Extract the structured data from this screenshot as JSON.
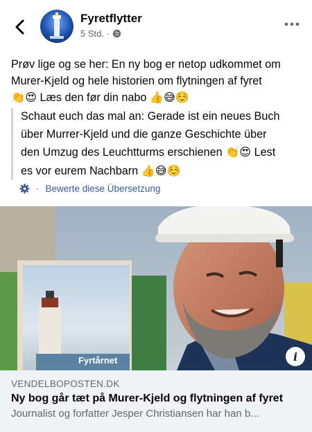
{
  "header": {
    "page_name": "Fyretflytter",
    "time": "5 Std.",
    "separator": "·",
    "back_icon": "chevron-left-icon",
    "privacy_icon": "globe-icon",
    "more_icon": "more-dots-icon"
  },
  "post": {
    "line1": "Prøv lige og se her: En ny bog er netop udkommet om",
    "line2": "Murer-Kjeld og hele historien om flytningen af fyret",
    "line3_emoji_a": "👏😍",
    "line3_text": " Læs den før din nabo ",
    "line3_emoji_b": "👍😅☺️"
  },
  "translation": {
    "line1": "Schaut euch das mal an: Gerade ist ein neues Buch",
    "line2": "über Murrer-Kjeld und die ganze Geschichte über",
    "line3_text": "den Umzug des Leuchtturms erschienen ",
    "line3_emoji": "👏😍",
    "line3_tail": " Lest",
    "line4_text": "es vor eurem Nachbarn ",
    "line4_emoji": "👍😅☺️"
  },
  "rate": {
    "label": "Bewerte diese Übersetzung",
    "separator": "·",
    "icon": "gear-icon"
  },
  "image": {
    "book_title": "Fyrtårnet",
    "info_label": "i"
  },
  "link": {
    "domain": "VENDELBOPOSTEN.DK",
    "title": "Ny bog går tæt på Murer-Kjeld og flytningen af fyret",
    "description": "Journalist og forfatter Jesper Christiansen har han b..."
  }
}
